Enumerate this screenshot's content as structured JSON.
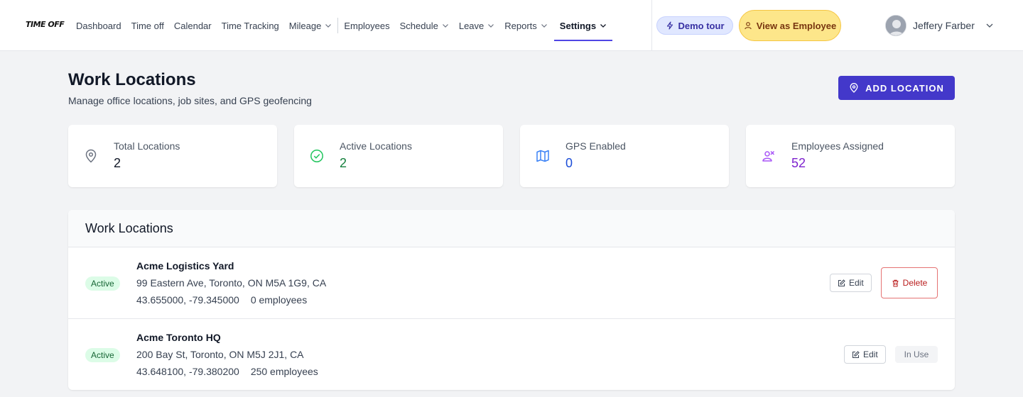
{
  "app": {
    "logo_text": "TIME OFF"
  },
  "nav": {
    "items": [
      {
        "label": "Dashboard",
        "dropdown": false
      },
      {
        "label": "Time off",
        "dropdown": false
      },
      {
        "label": "Calendar",
        "dropdown": false
      },
      {
        "label": "Time Tracking",
        "dropdown": false
      },
      {
        "label": "Mileage",
        "dropdown": true
      },
      {
        "label": "Employees",
        "dropdown": false
      },
      {
        "label": "Schedule",
        "dropdown": true
      },
      {
        "label": "Leave",
        "dropdown": true
      },
      {
        "label": "Reports",
        "dropdown": true
      },
      {
        "label": "Settings",
        "dropdown": true,
        "active": true
      }
    ],
    "demo_tour_label": "Demo tour",
    "view_as_employee_label": "View as Employee",
    "user_name": "Jeffery Farber"
  },
  "page": {
    "title": "Work Locations",
    "subtitle": "Manage office locations, job sites, and GPS geofencing",
    "add_button_label": "ADD LOCATION"
  },
  "stats": [
    {
      "label": "Total Locations",
      "value": "2",
      "icon": "map-pin-icon",
      "color": "#111827"
    },
    {
      "label": "Active Locations",
      "value": "2",
      "icon": "check-circle-icon",
      "color": "#15803d"
    },
    {
      "label": "GPS Enabled",
      "value": "0",
      "icon": "map-icon",
      "color": "#1d4ed8"
    },
    {
      "label": "Employees Assigned",
      "value": "52",
      "icon": "users-icon",
      "color": "#7e22ce"
    }
  ],
  "table": {
    "title": "Work Locations",
    "rows": [
      {
        "status": "Active",
        "name": "Acme Logistics Yard",
        "address": "99 Eastern Ave, Toronto, ON M5A 1G9, CA",
        "coords": "43.655000, -79.345000",
        "employees": "0 employees",
        "edit_label": "Edit",
        "action_label": "Delete",
        "action_type": "delete"
      },
      {
        "status": "Active",
        "name": "Acme Toronto HQ",
        "address": "200 Bay St, Toronto, ON M5J 2J1, CA",
        "coords": "43.648100, -79.380200",
        "employees": "250 employees",
        "edit_label": "Edit",
        "action_label": "In Use",
        "action_type": "in-use"
      }
    ]
  },
  "colors": {
    "accent": "#4338ca",
    "active_badge_bg": "#dcfce7",
    "active_badge_text": "#166534",
    "delete": "#b91c1c",
    "demo_bg": "#e0e7ff",
    "view_bg": "#fde68a"
  }
}
